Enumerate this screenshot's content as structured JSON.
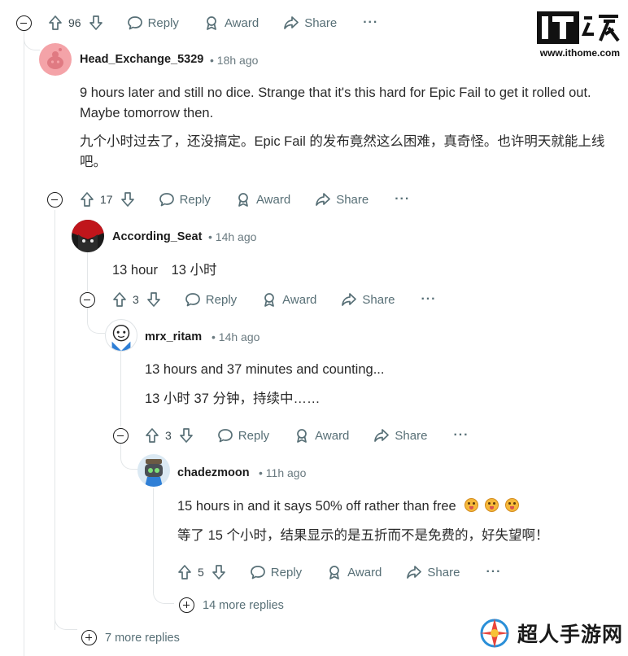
{
  "comments": [
    {
      "id": "c0",
      "votes": "96",
      "labels": {
        "reply": "Reply",
        "award": "Award",
        "share": "Share"
      }
    },
    {
      "id": "c1",
      "username": "Head_Exchange_5329",
      "time": "18h ago",
      "text_en": "9 hours later and still no dice. Strange that it's this hard for Epic Fail to get it rolled out. Maybe tomorrow then.",
      "text_zh": "九个小时过去了，还没搞定。Epic Fail 的发布竟然这么困难，真奇怪。也许明天就能上线吧。",
      "votes": "17",
      "labels": {
        "reply": "Reply",
        "award": "Award",
        "share": "Share"
      }
    },
    {
      "id": "c2",
      "username": "According_Seat",
      "time": "14h ago",
      "text_en": "13 hour",
      "text_zh": "13 小时",
      "votes": "3",
      "labels": {
        "reply": "Reply",
        "award": "Award",
        "share": "Share"
      }
    },
    {
      "id": "c3",
      "username": "mrx_ritam",
      "time": "14h ago",
      "text_en": "13 hours and 37 minutes and counting...",
      "text_zh": "13 小时 37 分钟，持续中……",
      "votes": "3",
      "labels": {
        "reply": "Reply",
        "award": "Award",
        "share": "Share"
      }
    },
    {
      "id": "c4",
      "username": "chadezmoon",
      "time": "11h ago",
      "text_en": "15 hours in and it says 50% off rather than free",
      "text_zh": "等了 15 个小时，结果显示的是五折而不是免费的，好失望啊！",
      "votes": "5",
      "labels": {
        "reply": "Reply",
        "award": "Award",
        "share": "Share"
      }
    }
  ],
  "more_replies": {
    "inner": "14 more replies",
    "outer": "7 more replies"
  },
  "watermarks": {
    "ithome_logo": "IT之家",
    "ithome_url": "www.ithome.com",
    "brand": "超人手游网"
  },
  "colors": {
    "meta_gray": "#576f76",
    "thread_line": "#e3e6e8",
    "avatar_pink": "#f4a3a8"
  },
  "icons": [
    "upvote-icon",
    "downvote-icon",
    "reply-icon",
    "award-icon",
    "share-icon",
    "more-icon",
    "collapse-icon",
    "expand-icon"
  ]
}
